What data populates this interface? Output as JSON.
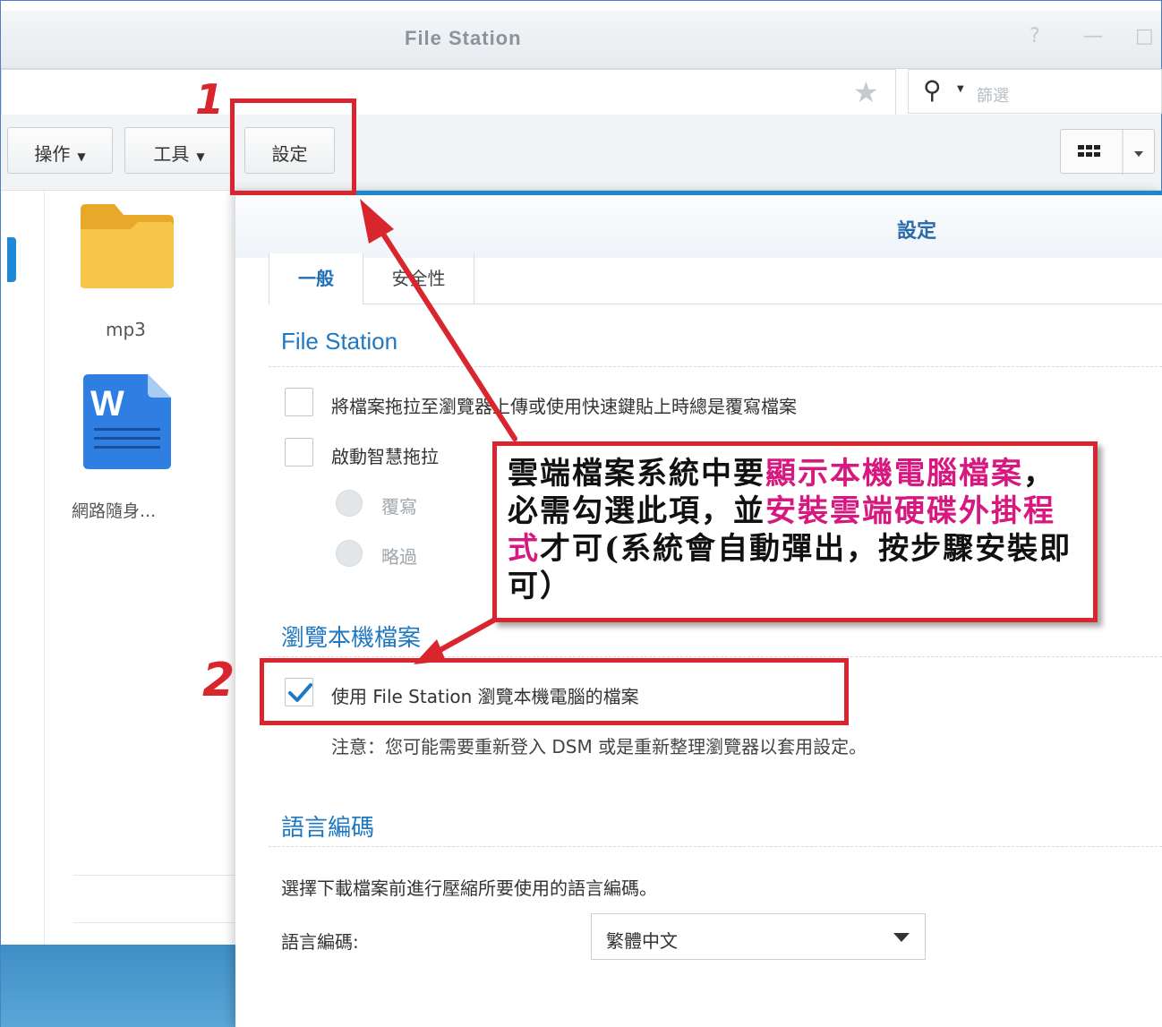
{
  "window": {
    "title": "File Station",
    "controls": [
      "?",
      "—",
      "□"
    ]
  },
  "filter": {
    "placeholder": "篩選",
    "icon": "search-icon"
  },
  "toolbar": {
    "actions_label": "操作",
    "tools_label": "工具",
    "settings_label": "設定"
  },
  "files": [
    {
      "name": "mp3",
      "icon": "folder-icon"
    },
    {
      "name": "網路隨身...",
      "icon": "word-document-icon"
    }
  ],
  "settings_panel": {
    "title": "設定",
    "tabs": [
      {
        "label": "一般",
        "active": true
      },
      {
        "label": "安全性",
        "active": false
      }
    ],
    "file_station_section": {
      "heading": "File Station",
      "overwrite_upload_label": "將檔案拖拉至瀏覽器上傳或使用快速鍵貼上時總是覆寫檔案",
      "smart_drag_label": "啟動智慧拖拉",
      "overwrite_label": "覆寫",
      "skip_label": "略過"
    },
    "local_browse_section": {
      "heading": "瀏覽本機檔案",
      "checkbox_label": "使用 File Station 瀏覽本機電腦的檔案",
      "checked": true,
      "note": "注意：您可能需要重新登入 DSM 或是重新整理瀏覽器以套用設定。"
    },
    "encoding_section": {
      "heading": "語言編碼",
      "description": "選擇下載檔案前進行壓縮所要使用的語言編碼。",
      "field_label": "語言編碼:",
      "selected": "繁體中文"
    }
  },
  "annotations": {
    "step1": "1",
    "step2": "2",
    "callout_a": "雲端檔案系統中要",
    "callout_b": "顯示本機電腦檔案",
    "callout_c": "，必需勾選此項，並",
    "callout_d": "安裝雲端硬碟外",
    "callout_e": "掛程式",
    "callout_f": "才可(系統會自動彈出，按步驟安裝即可）",
    "accent_color": "#d9262e",
    "highlight_color": "#d6187f"
  }
}
